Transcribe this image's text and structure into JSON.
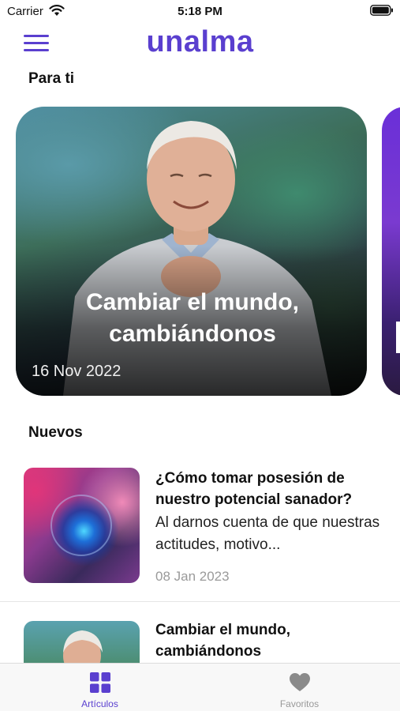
{
  "status_bar": {
    "carrier": "Carrier",
    "time": "5:18 PM"
  },
  "header": {
    "logo": "unalma",
    "menu_icon": "hamburger-menu-icon"
  },
  "sections": {
    "for_you": "Para ti",
    "new": "Nuevos"
  },
  "featured": [
    {
      "title": "Cambiar el mundo, cambiándonos",
      "date": "16 Nov 2022"
    }
  ],
  "articles": [
    {
      "title": "¿Cómo tomar posesión de nuestro potencial sanador?",
      "excerpt": "Al darnos cuenta de que nuestras actitudes, motivo...",
      "date": "08 Jan 2023"
    },
    {
      "title": "Cambiar el mundo, cambiándonos"
    }
  ],
  "tab_bar": {
    "tabs": [
      {
        "label": "Artículos",
        "icon": "grid-icon",
        "active": true
      },
      {
        "label": "Favoritos",
        "icon": "heart-icon",
        "active": false
      }
    ]
  },
  "colors": {
    "brand": "#5a3fcf",
    "inactive": "#999999"
  }
}
